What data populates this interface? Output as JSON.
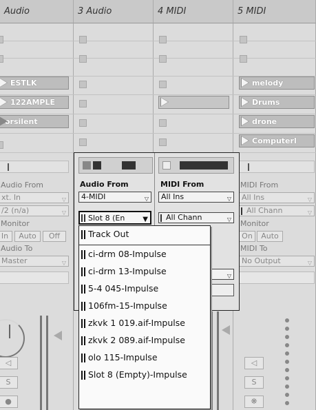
{
  "tracks": [
    {
      "title": "Audio"
    },
    {
      "title": "3 Audio"
    },
    {
      "title": "4 MIDI"
    },
    {
      "title": "5 MIDI"
    }
  ],
  "clips": {
    "track1": [
      "ESTLK",
      "122AMPLE",
      "orsilent"
    ],
    "track4": [
      "melody",
      "Drums",
      "drone",
      "Computerl"
    ]
  },
  "io": {
    "audio_from_label": "Audio From",
    "midi_from_label": "MIDI From",
    "col1_from": "xt. In",
    "col1_ch": "/2 (n/a)",
    "col2_from": "4-MIDI",
    "col2_ch": "Slot 8 (En",
    "col3_from": "All Ins",
    "col3_ch": "All Chann",
    "col4_from": "All Ins",
    "col4_ch": "All Chann",
    "monitor_label": "Monitor",
    "monitor_options": [
      "In",
      "Auto",
      "Off"
    ],
    "col4_monitor_options": [
      "On",
      "Auto"
    ],
    "audio_to_label": "Audio To",
    "midi_to_label": "MIDI To",
    "col1_to": "Master",
    "col4_to": "No Output"
  },
  "menu": {
    "items": [
      "Track Out",
      "ci-drm 08-Impulse",
      "ci-drm 13-Impulse",
      "5-4 045-Impulse",
      "106fm-15-Impulse",
      "zkvk 1 019.aif-Impulse",
      "zkvk 2 089.aif-Impulse",
      "olo 115-Impulse",
      "Slot 8 (Empty)-Impulse"
    ]
  },
  "mixer": {
    "solo_label": "S"
  }
}
